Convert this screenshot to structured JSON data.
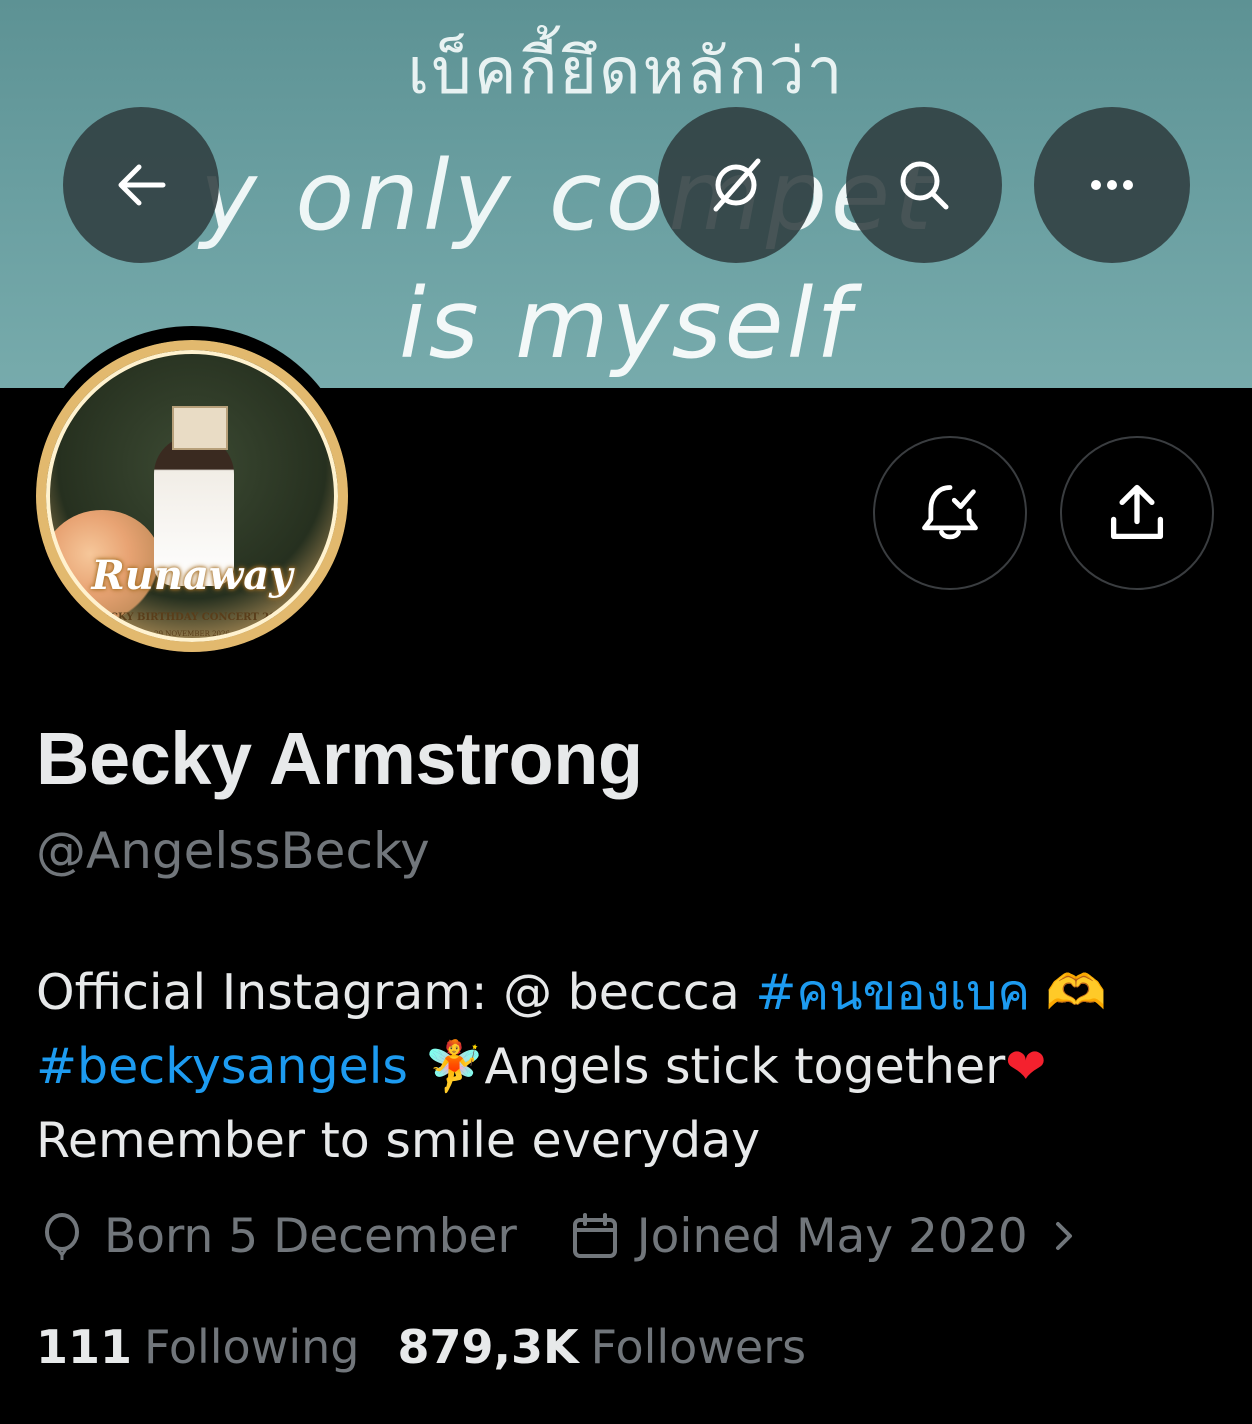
{
  "banner": {
    "line1": "เบ็คกี้ยึดหลักว่า",
    "line2": "y only compet",
    "line3": "is myself"
  },
  "header_buttons": {
    "back_icon": "back-arrow-icon",
    "grok_icon": "grok-icon",
    "search_icon": "search-icon",
    "more_icon": "more-icon"
  },
  "avatar": {
    "logo_text": "Runaway",
    "subtext": "BECKY BIRTHDAY CONCERT 2026",
    "date": "29 NOVEMBER 2026"
  },
  "actions": {
    "notify_icon": "bell-check-icon",
    "share_icon": "share-icon"
  },
  "profile": {
    "name": "Becky Armstrong",
    "handle": "@AngelssBecky",
    "bio": {
      "line1_text": "Official Instagram: @ beccca ",
      "line1_hashtag": "#คนของเบค",
      "line1_emoji": " 🫶",
      "line2_hashtag": "#beckysangels",
      "line2_emoji": " 🧚",
      "line2_text": "Angels stick together",
      "line2_heart": "❤",
      "line3_text": "Remember to smile everyday"
    },
    "born": "Born 5 December",
    "joined": "Joined May 2020",
    "following_count": "111",
    "following_label": "Following",
    "followers_count": "879,3K",
    "followers_label": "Followers"
  },
  "colors": {
    "background": "#000000",
    "text_primary": "#e7e9ea",
    "text_secondary": "#71767b",
    "link": "#1d9bf0",
    "banner": "#6a9fa1"
  }
}
